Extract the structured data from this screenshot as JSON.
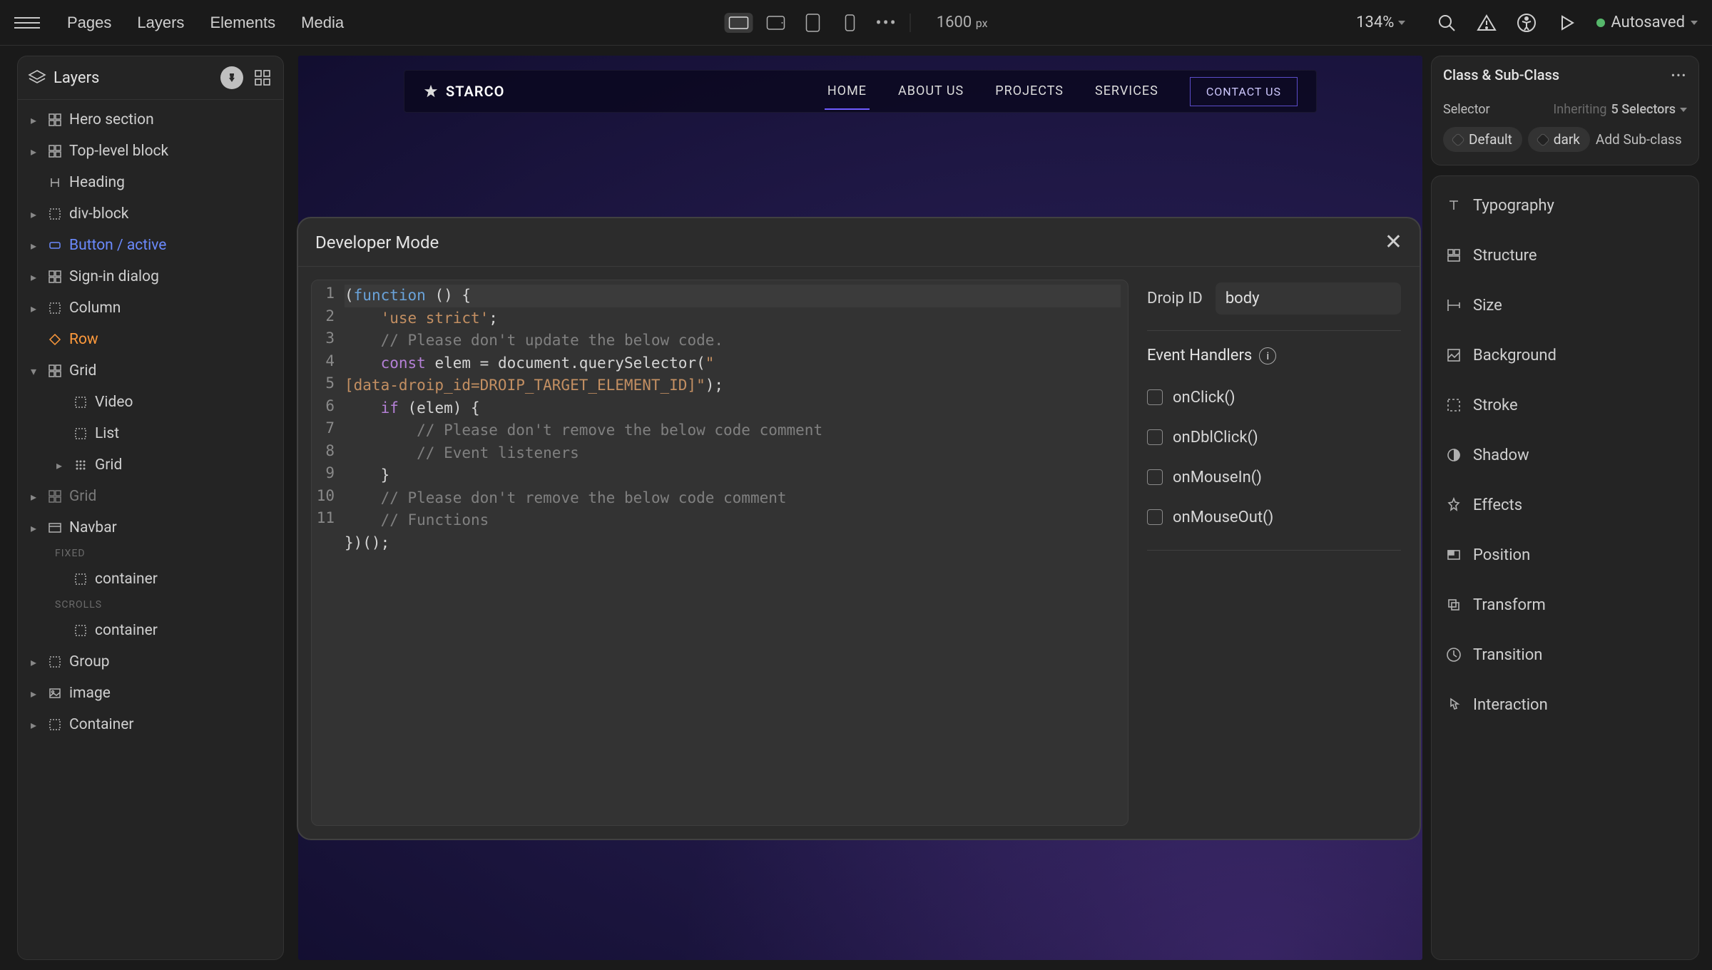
{
  "topbar": {
    "tabs": {
      "pages": "Pages",
      "layers": "Layers",
      "elements": "Elements",
      "media": "Media"
    },
    "viewport_value": "1600",
    "viewport_unit": "px",
    "zoom": "134%",
    "autosave_label": "Autosaved"
  },
  "layers_panel": {
    "title": "Layers",
    "items": [
      {
        "toggle": "▸",
        "icon": "grid",
        "label": "Hero section",
        "indent": 0
      },
      {
        "toggle": "▸",
        "icon": "grid",
        "label": "Top-level block",
        "indent": 0
      },
      {
        "toggle": "",
        "icon": "heading",
        "label": "Heading",
        "indent": 0
      },
      {
        "toggle": "▸",
        "icon": "div",
        "label": "div-block",
        "indent": 0
      },
      {
        "toggle": "▸",
        "icon": "button",
        "label": "Button / active",
        "indent": 0,
        "active": true
      },
      {
        "toggle": "▸",
        "icon": "grid",
        "label": "Sign-in dialog",
        "indent": 0
      },
      {
        "toggle": "▸",
        "icon": "div",
        "label": "Column",
        "indent": 0
      },
      {
        "toggle": "",
        "icon": "row",
        "label": "Row",
        "indent": 0,
        "orange": true
      },
      {
        "toggle": "▾",
        "icon": "grid",
        "label": "Grid",
        "indent": 0
      },
      {
        "toggle": "",
        "icon": "div",
        "label": "Video",
        "indent": 1
      },
      {
        "toggle": "",
        "icon": "div",
        "label": "List",
        "indent": 1
      },
      {
        "toggle": "▸",
        "icon": "dotgrid",
        "label": "Grid",
        "indent": 1
      },
      {
        "toggle": "▸",
        "icon": "grid",
        "label": "Grid",
        "indent": 0,
        "dim": true
      },
      {
        "toggle": "▸",
        "icon": "navbar",
        "label": "Navbar",
        "indent": 0
      }
    ],
    "fixed_label": "FIXED",
    "fixed_items": [
      {
        "toggle": "",
        "icon": "div",
        "label": "container",
        "indent": 1
      }
    ],
    "scrolls_label": "SCROLLS",
    "scrolls_items": [
      {
        "toggle": "",
        "icon": "div",
        "label": "container",
        "indent": 1
      }
    ],
    "tail_items": [
      {
        "toggle": "▸",
        "icon": "div",
        "label": "Group",
        "indent": 0
      },
      {
        "toggle": "▸",
        "icon": "image",
        "label": "image",
        "indent": 0
      },
      {
        "toggle": "▸",
        "icon": "div",
        "label": "Container",
        "indent": 0
      }
    ]
  },
  "site_nav": {
    "brand": "STARCO",
    "links": {
      "home": "HOME",
      "about": "ABOUT US",
      "projects": "PROJECTS",
      "services": "SERVICES"
    },
    "cta": "CONTACT US"
  },
  "class_panel": {
    "title": "Class & Sub-Class",
    "selector_label": "Selector",
    "inherit_prefix": "Inheriting",
    "inherit_count": "5 Selectors",
    "pill_default": "Default",
    "pill_dark": "dark",
    "add_sub": "Add Sub-class"
  },
  "props": {
    "typography": "Typography",
    "structure": "Structure",
    "size": "Size",
    "background": "Background",
    "stroke": "Stroke",
    "shadow": "Shadow",
    "effects": "Effects",
    "position": "Position",
    "transform": "Transform",
    "transition": "Transition",
    "interaction": "Interaction"
  },
  "modal": {
    "title": "Developer Mode",
    "droip_id_label": "Droip ID",
    "droip_id_value": "body",
    "event_handlers_label": "Event Handlers",
    "events": {
      "onclick": "onClick()",
      "ondbl": "onDblClick()",
      "onmousein": "onMouseIn()",
      "onmouseout": "onMouseOut()"
    },
    "code_lines": [
      1,
      2,
      3,
      4,
      5,
      6,
      7,
      8,
      9,
      10,
      11
    ]
  }
}
